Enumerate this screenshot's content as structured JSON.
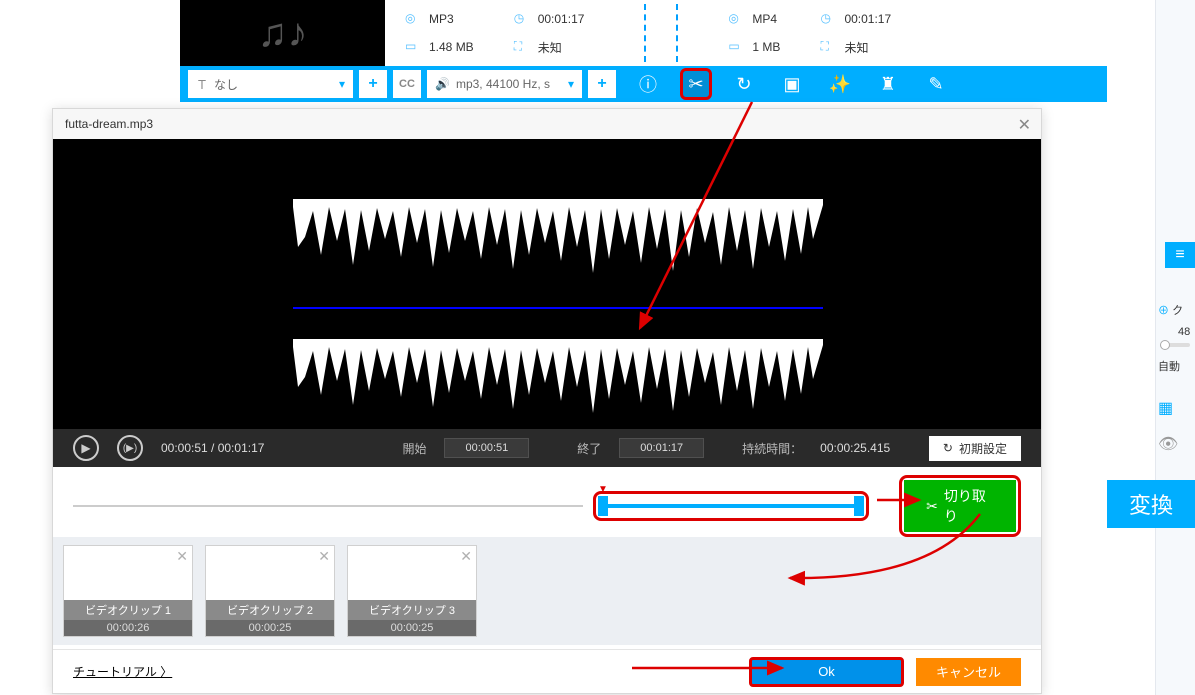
{
  "info": {
    "src": {
      "format": "MP3",
      "duration": "00:01:17",
      "size": "1.48 MB",
      "dim": "未知"
    },
    "dst": {
      "format": "MP4",
      "duration": "00:01:17",
      "size": "1 MB",
      "dim": "未知"
    }
  },
  "toolbar": {
    "text_dd": "なし",
    "audio_dd": "mp3, 44100 Hz, s",
    "plus": "+"
  },
  "right": {
    "value48": "48",
    "auto": "自動",
    "cl": "ク"
  },
  "convert": "変換",
  "dialog": {
    "title": "futta-dream.mp3",
    "time_pos": "00:00:51 / 00:01:17",
    "start_lbl": "開始",
    "start_val": "00:00:51",
    "end_lbl": "終了",
    "end_val": "00:01:17",
    "dur_lbl": "持続時間：",
    "dur_val": "00:00:25.415",
    "reset": "初期設定",
    "cut": "切り取り",
    "clips": [
      {
        "name": "ビデオクリップ 1",
        "time": "00:00:26"
      },
      {
        "name": "ビデオクリップ 2",
        "time": "00:00:25"
      },
      {
        "name": "ビデオクリップ 3",
        "time": "00:00:25"
      }
    ],
    "tutorial": "チュートリアル 〉",
    "ok": "Ok",
    "cancel": "キャンセル"
  }
}
